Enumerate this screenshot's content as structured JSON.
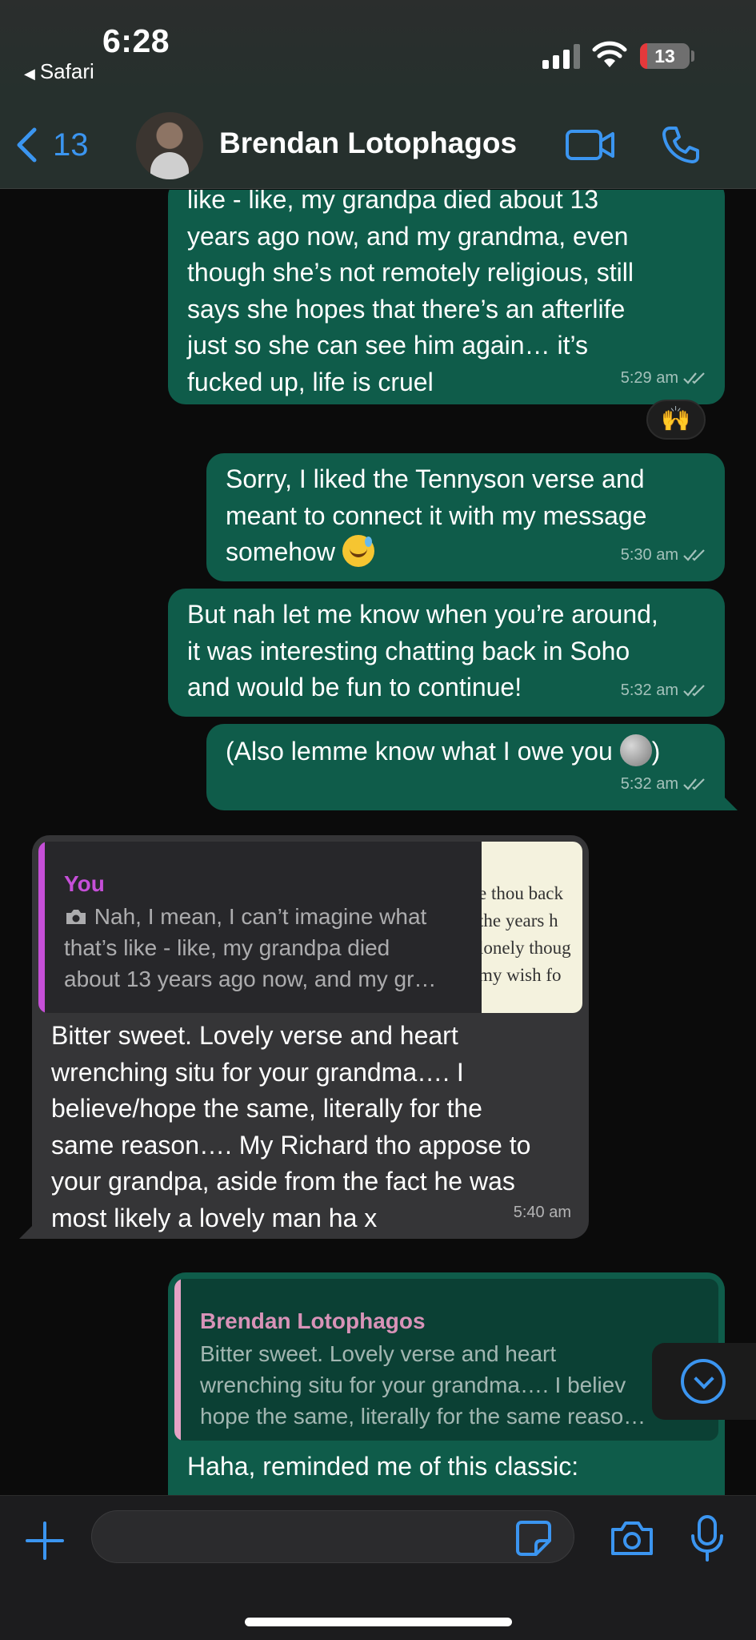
{
  "status_bar": {
    "time": "6:28",
    "back_app": "Safari",
    "battery": "13"
  },
  "header": {
    "back_count": "13",
    "contact_name": "Brendan Lotophagos"
  },
  "messages": [
    {
      "dir": "out",
      "lines": [
        "like - like, my grandpa died about 13",
        "years ago now, and my grandma, even",
        "though she’s not remotely religious, still",
        "says she hopes that there’s an afterlife",
        "just so she can see him again… it’s",
        "fucked up, life is cruel"
      ],
      "time": "5:29 am",
      "reaction": "🙌"
    },
    {
      "dir": "out",
      "lines": [
        "Sorry, I liked the Tennyson verse and",
        "meant to connect it with my message",
        "somehow"
      ],
      "time": "5:30 am"
    },
    {
      "dir": "out",
      "lines": [
        "But nah let me know when you’re around,",
        "it was interesting chatting back in Soho",
        "and would be fun to continue!"
      ],
      "time": "5:32 am"
    },
    {
      "dir": "out",
      "lines": [
        "(Also lemme know what I owe you",
        ")"
      ],
      "time": "5:32 am"
    },
    {
      "dir": "in",
      "quote_name": "You",
      "quote_lines": [
        "Nah, I mean, I can’t imagine what",
        "that’s like - like, my grandpa died",
        "about 13 years ago now, and my gr…"
      ],
      "thumb_lines": [
        "e thou back",
        " the years h",
        "lonely thoug",
        " my wish fo"
      ],
      "lines": [
        "Bitter sweet. Lovely verse and heart",
        "wrenching situ for your grandma…. I",
        "believe/hope the same, literally for the",
        "same reason…. My Richard tho appose to",
        "your grandpa, aside from the fact he was",
        "most likely a lovely man ha x"
      ],
      "time": "5:40 am"
    },
    {
      "dir": "out",
      "quote_name": "Brendan Lotophagos",
      "quote_lines": [
        "Bitter sweet. Lovely verse and heart",
        "wrenching situ for your grandma…. I believ",
        "hope the same, literally for the same reaso…"
      ],
      "lines": [
        "Haha, reminded me of this classic:"
      ]
    }
  ],
  "input": {
    "placeholder": ""
  },
  "colors": {
    "accent": "#3b95f0",
    "outgoing": "#0f5c4a",
    "incoming": "#353537",
    "you_quote": "#c64fd8",
    "brendan_quote": "#e6a3c6"
  }
}
